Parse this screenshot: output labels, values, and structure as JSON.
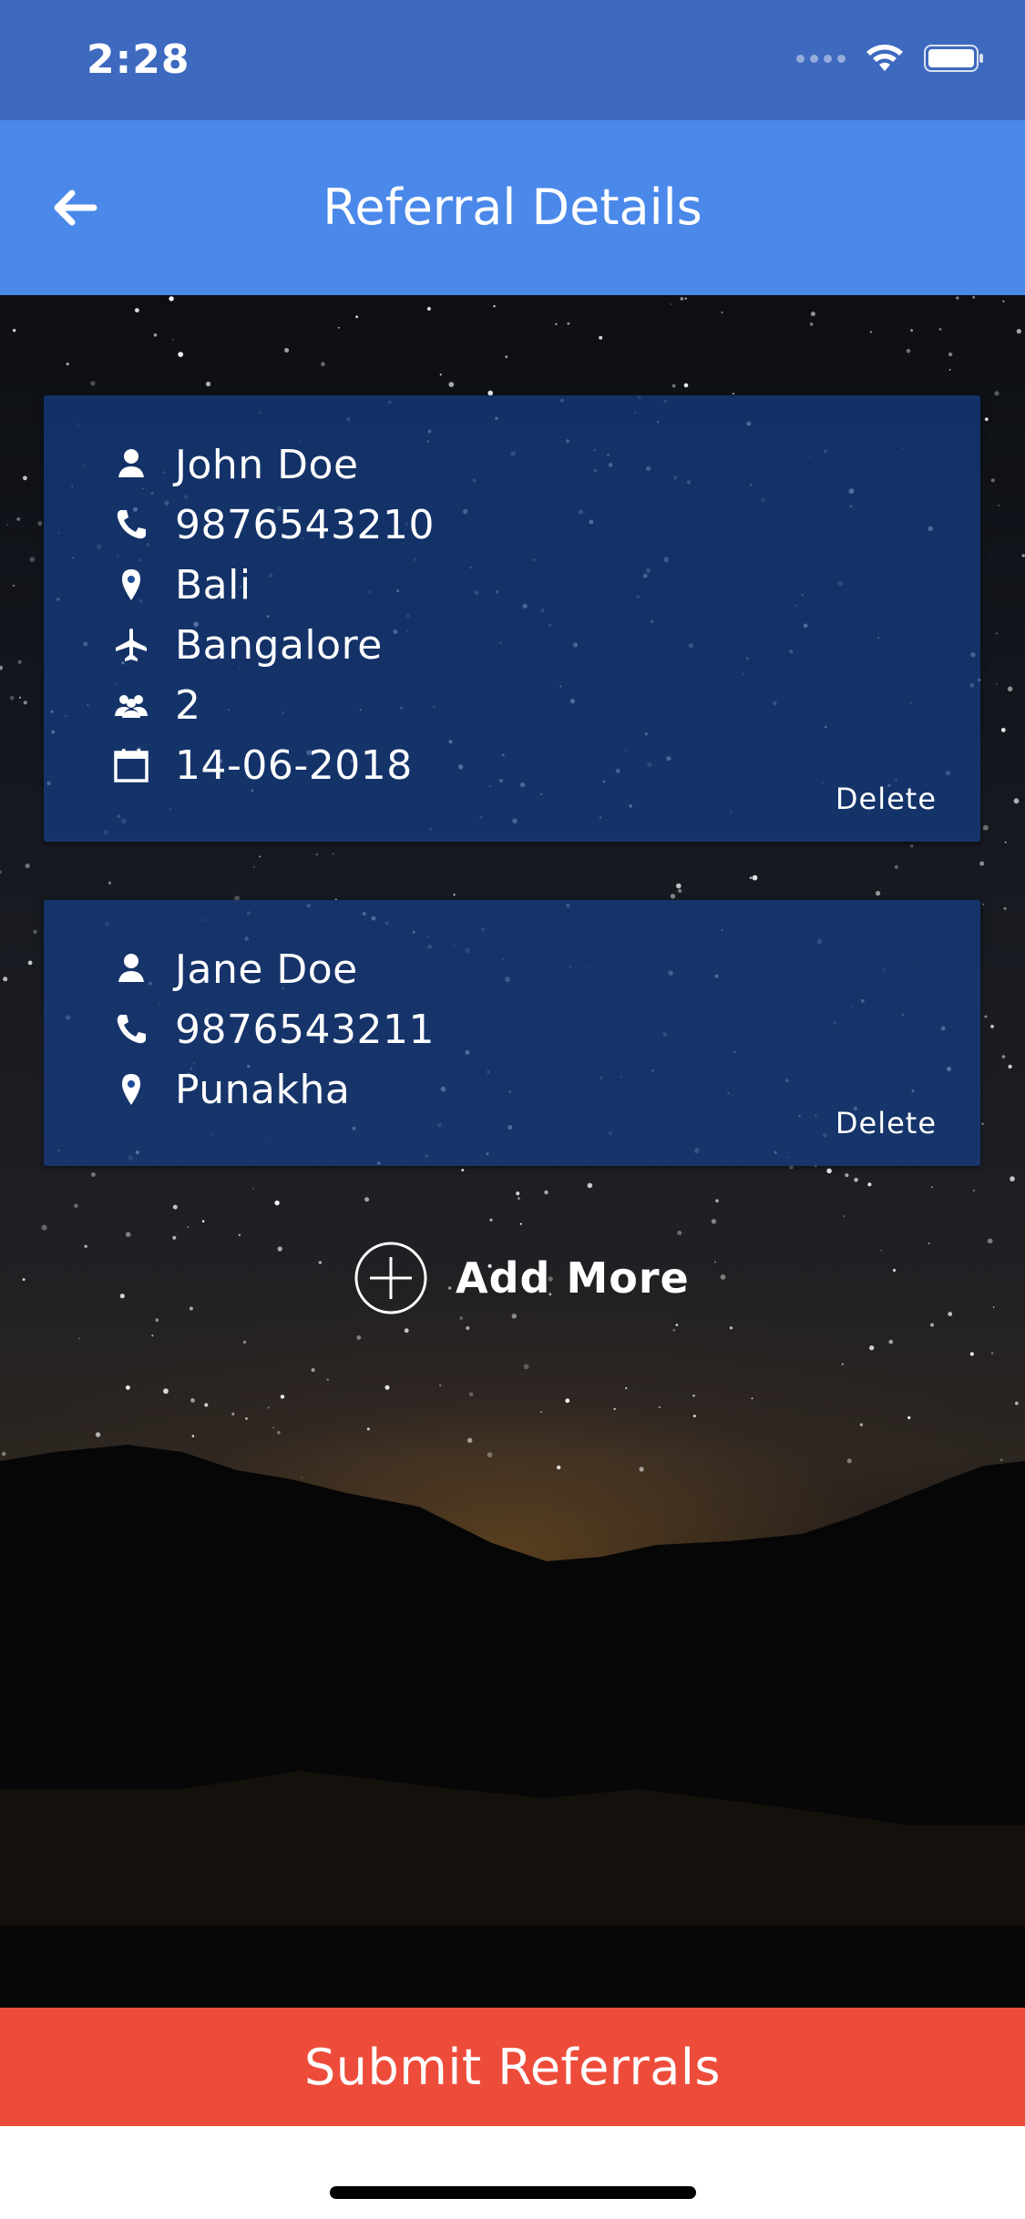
{
  "status_bar": {
    "time": "2:28"
  },
  "header": {
    "title": "Referral Details"
  },
  "referrals": [
    {
      "name": "John Doe",
      "phone": "9876543210",
      "destination": "Bali",
      "departure_city": "Bangalore",
      "travellers": "2",
      "date": "14-06-2018",
      "delete_label": "Delete"
    },
    {
      "name": "Jane Doe",
      "phone": "9876543211",
      "destination": "Punakha",
      "delete_label": "Delete"
    }
  ],
  "add_more_label": "Add More",
  "submit_label": "Submit Referrals",
  "colors": {
    "status_bar": "#3d69bf",
    "app_bar": "#4a88ea",
    "card": "#153e87",
    "submit": "#ee4c3b"
  },
  "icons": [
    "back-arrow-icon",
    "person-icon",
    "phone-icon",
    "location-pin-icon",
    "airplane-icon",
    "group-icon",
    "calendar-icon",
    "add-circle-icon",
    "wifi-icon",
    "battery-icon"
  ]
}
